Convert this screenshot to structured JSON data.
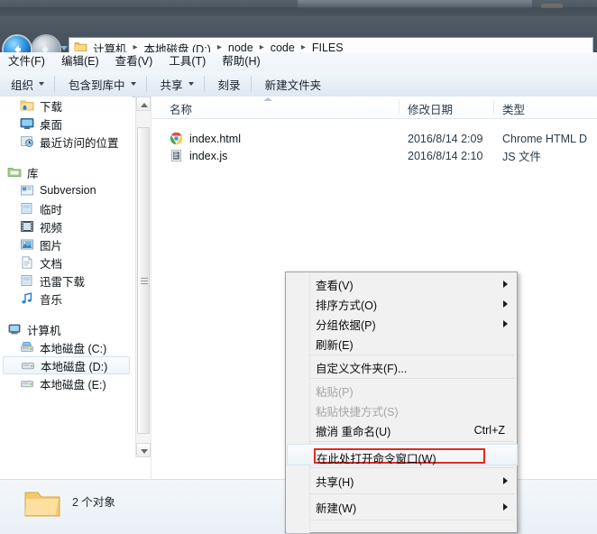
{
  "window": {
    "titlebar_color": "#4a5560",
    "accent": "#e02b20"
  },
  "address_bar": {
    "back_icon": "back-arrow-icon",
    "forward_icon": "forward-arrow-icon",
    "history_icon": "history-dropdown-icon",
    "folder_icon": "folder-icon",
    "separator": "▸",
    "crumbs": [
      "计算机",
      "本地磁盘 (D:)",
      "node",
      "code",
      "FILES"
    ]
  },
  "menubar": {
    "items": [
      "文件(F)",
      "编辑(E)",
      "查看(V)",
      "工具(T)",
      "帮助(H)"
    ]
  },
  "toolbar": {
    "items": [
      {
        "label": "组织",
        "caret": true
      },
      {
        "label": "包含到库中",
        "caret": true
      },
      {
        "label": "共享",
        "caret": true
      },
      {
        "label": "刻录",
        "caret": false
      },
      {
        "label": "新建文件夹",
        "caret": false
      }
    ]
  },
  "sidebar": {
    "groups": [
      {
        "items": [
          {
            "label": "下载",
            "icon": "downloads-icon",
            "level": 1,
            "selected": false
          },
          {
            "label": "桌面",
            "icon": "desktop-icon",
            "level": 1,
            "selected": false
          },
          {
            "label": "最近访问的位置",
            "icon": "recent-places-icon",
            "level": 1,
            "selected": false
          }
        ]
      },
      {
        "items": [
          {
            "label": "库",
            "icon": "library-icon",
            "level": 0,
            "selected": false
          },
          {
            "label": "Subversion",
            "icon": "subversion-icon",
            "level": 1,
            "selected": false
          },
          {
            "label": "临时",
            "icon": "temp-folder-icon",
            "level": 1,
            "selected": false
          },
          {
            "label": "视频",
            "icon": "videos-icon",
            "level": 1,
            "selected": false
          },
          {
            "label": "图片",
            "icon": "pictures-icon",
            "level": 1,
            "selected": false
          },
          {
            "label": "文档",
            "icon": "documents-icon",
            "level": 1,
            "selected": false
          },
          {
            "label": "迅雷下载",
            "icon": "thunder-download-icon",
            "level": 1,
            "selected": false
          },
          {
            "label": "音乐",
            "icon": "music-icon",
            "level": 1,
            "selected": false
          }
        ]
      },
      {
        "items": [
          {
            "label": "计算机",
            "icon": "computer-icon",
            "level": 0,
            "selected": false
          },
          {
            "label": "本地磁盘 (C:)",
            "icon": "system-drive-icon",
            "level": 1,
            "selected": false
          },
          {
            "label": "本地磁盘 (D:)",
            "icon": "drive-icon",
            "level": 1,
            "selected": true
          },
          {
            "label": "本地磁盘 (E:)",
            "icon": "drive-icon",
            "level": 1,
            "selected": false
          }
        ]
      }
    ]
  },
  "file_list": {
    "columns": [
      {
        "label": "名称",
        "sorted": true
      },
      {
        "label": "修改日期",
        "sorted": false
      },
      {
        "label": "类型",
        "sorted": false
      }
    ],
    "rows": [
      {
        "name": "index.html",
        "icon": "chrome-icon",
        "date": "2016/8/14 2:09",
        "type": "Chrome HTML D"
      },
      {
        "name": "index.js",
        "icon": "script-file-icon",
        "date": "2016/8/14 2:10",
        "type": "JS 文件"
      }
    ]
  },
  "status_bar": {
    "icon": "folder-icon",
    "text": "2 个对象"
  },
  "context_menu": {
    "items": [
      {
        "label": "查看(V)",
        "submenu": true,
        "disabled": false,
        "accel": "",
        "highlighted": false,
        "sep_after": false
      },
      {
        "label": "排序方式(O)",
        "submenu": true,
        "disabled": false,
        "accel": "",
        "highlighted": false,
        "sep_after": false
      },
      {
        "label": "分组依据(P)",
        "submenu": true,
        "disabled": false,
        "accel": "",
        "highlighted": false,
        "sep_after": false
      },
      {
        "label": "刷新(E)",
        "submenu": false,
        "disabled": false,
        "accel": "",
        "highlighted": false,
        "sep_after": true
      },
      {
        "label": "自定义文件夹(F)...",
        "submenu": false,
        "disabled": false,
        "accel": "",
        "highlighted": false,
        "sep_after": true
      },
      {
        "label": "粘贴(P)",
        "submenu": false,
        "disabled": true,
        "accel": "",
        "highlighted": false,
        "sep_after": false
      },
      {
        "label": "粘贴快捷方式(S)",
        "submenu": false,
        "disabled": true,
        "accel": "",
        "highlighted": false,
        "sep_after": false
      },
      {
        "label": "撤消 重命名(U)",
        "submenu": false,
        "disabled": false,
        "accel": "Ctrl+Z",
        "highlighted": false,
        "sep_after": true
      },
      {
        "label": "在此处打开命令窗口(W)",
        "submenu": false,
        "disabled": false,
        "accel": "",
        "highlighted": true,
        "sep_after": true
      },
      {
        "label": "共享(H)",
        "submenu": true,
        "disabled": false,
        "accel": "",
        "highlighted": false,
        "sep_after": true
      },
      {
        "label": "新建(W)",
        "submenu": true,
        "disabled": false,
        "accel": "",
        "highlighted": false,
        "sep_after": true
      }
    ]
  }
}
